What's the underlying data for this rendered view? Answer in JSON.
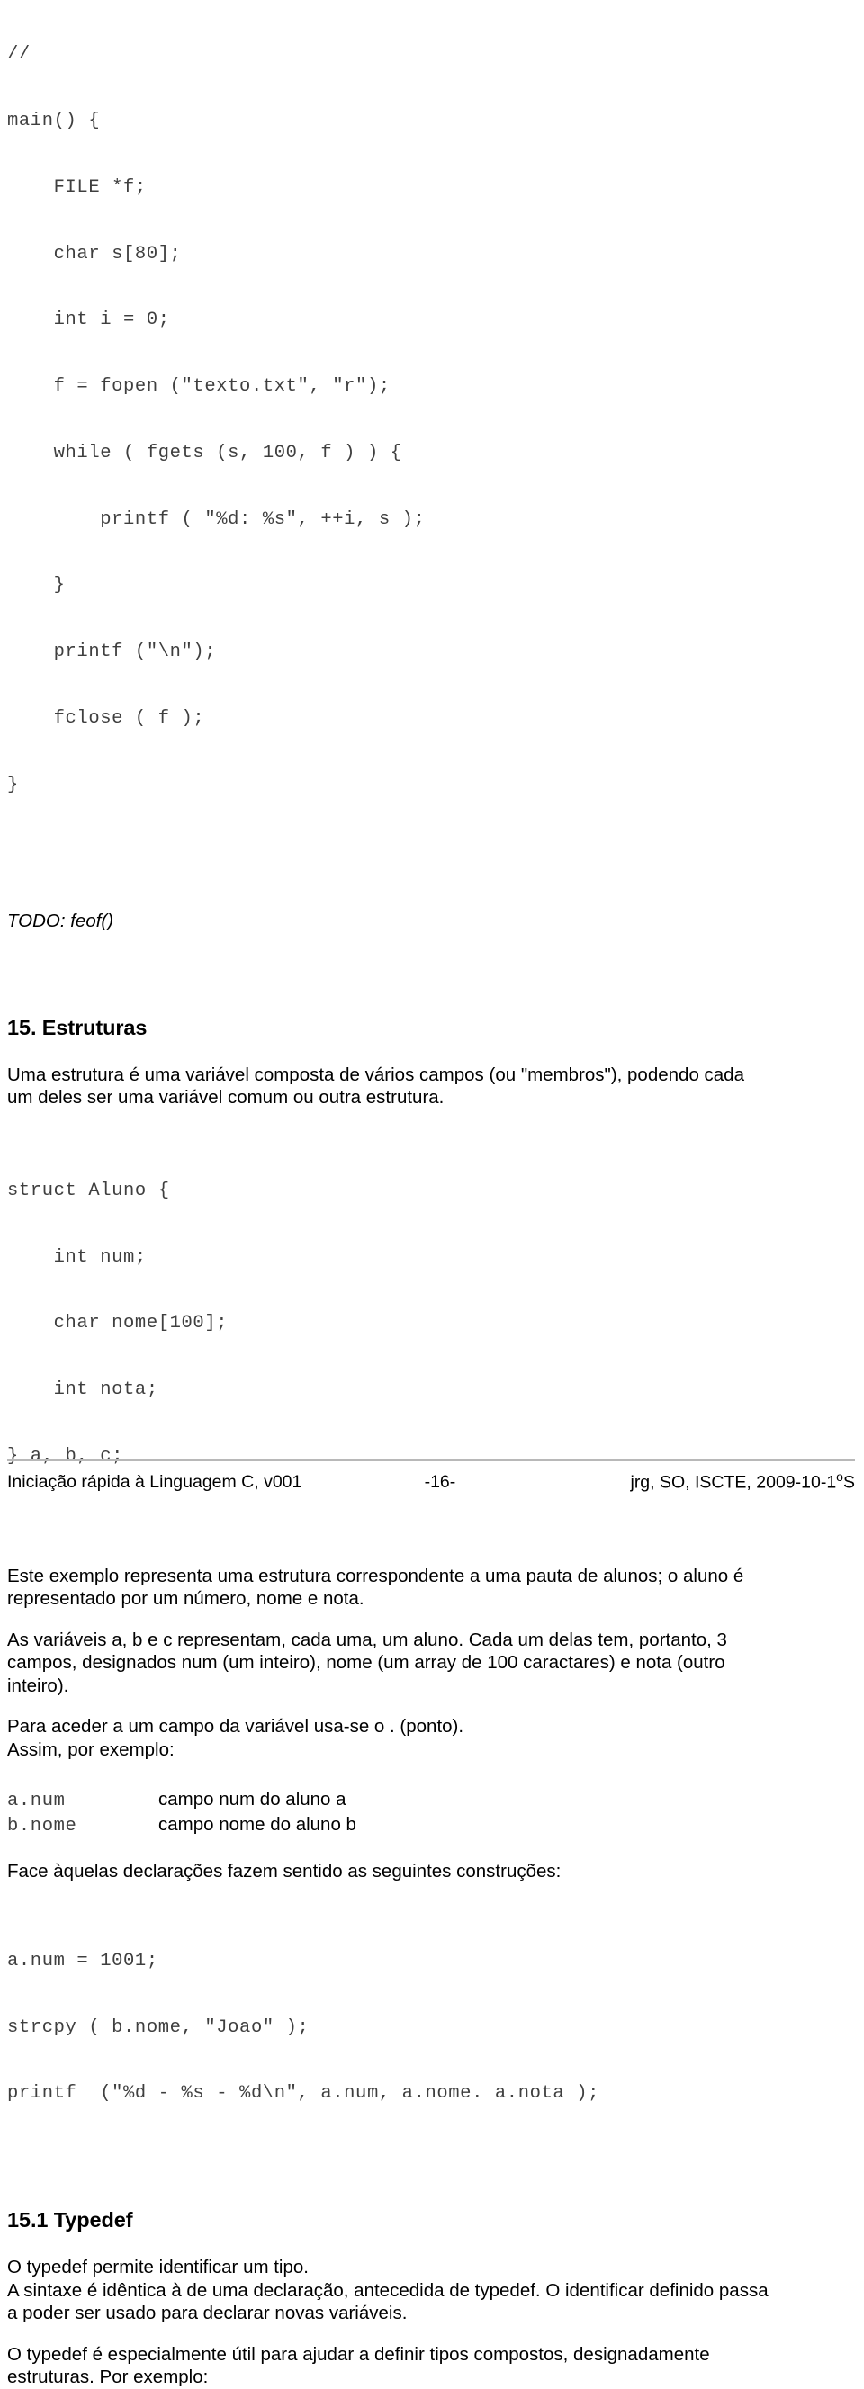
{
  "document": {
    "title": "Iniciação rápida à Linguagem C",
    "page_number": "-16-"
  },
  "code_block_main": {
    "lines": [
      "//",
      "main() {",
      "    FILE *f;",
      "    char s[80];",
      "    int i = 0;",
      "    f = fopen (\"texto.txt\", \"r\");",
      "    while ( fgets (s, 100, f ) ) {",
      "        printf ( \"%d: %s\", ++i, s );",
      "    }",
      "    printf (\"\\n\");",
      "    fclose ( f );",
      "}"
    ]
  },
  "todo_note": "TODO: feof()",
  "section_15": {
    "heading": "15. Estruturas",
    "intro": [
      "Uma estrutura é uma variável composta de vários campos (ou \"membros\"), podendo cada",
      "um deles ser uma variável comum ou outra estrutura."
    ],
    "struct_code": {
      "lines": [
        "struct Aluno {",
        "    int num;",
        "    char nome[100];",
        "    int nota;",
        "} a, b, c;"
      ]
    },
    "para_exemplo": [
      "Este exemplo representa uma estrutura correspondente a uma pauta de alunos; o aluno é",
      "representado por um número, nome e nota."
    ],
    "para_variaveis": [
      "As variáveis a, b e c representam, cada uma, um aluno. Cada um delas tem, portanto, 3",
      "campos, designados num (um inteiro), nome (um array de 100 caractares) e nota (outro",
      "inteiro)."
    ],
    "para_acesso": [
      "Para aceder a um campo da variável usa-se o . (ponto).",
      "Assim, por exemplo:"
    ],
    "field_examples": [
      {
        "code": "a.num",
        "desc": "campo  num do aluno a"
      },
      {
        "code": "b.nome",
        "desc": "campo nome do aluno b"
      }
    ],
    "para_face": "Face àquelas declarações fazem sentido as seguintes construções:",
    "usage_code": {
      "lines": [
        "a.num = 1001;",
        "strcpy ( b.nome, \"Joao\" );",
        "printf  (\"%d - %s - %d\\n\", a.num, a.nome. a.nota );"
      ]
    }
  },
  "section_15_1": {
    "heading": "15.1 Typedef",
    "para_typedef": [
      "O typedef permite identificar um tipo.",
      "A sintaxe é idêntica à de uma declaração, antecedida de typedef. O identificar definido passa",
      "a poder ser usado para declarar novas variáveis."
    ],
    "para_util": [
      "O typedef é especialmente útil para ajudar a definir tipos compostos, designadamente",
      "estruturas. Por exemplo:"
    ]
  },
  "footer": {
    "left": "Iniciação rápida à Linguagem C, v001",
    "center": "-16-",
    "right_prefix": "jrg, SO, ISCTE, 2009-10-1",
    "right_ordinal": "o",
    "right_suffix": "S"
  }
}
